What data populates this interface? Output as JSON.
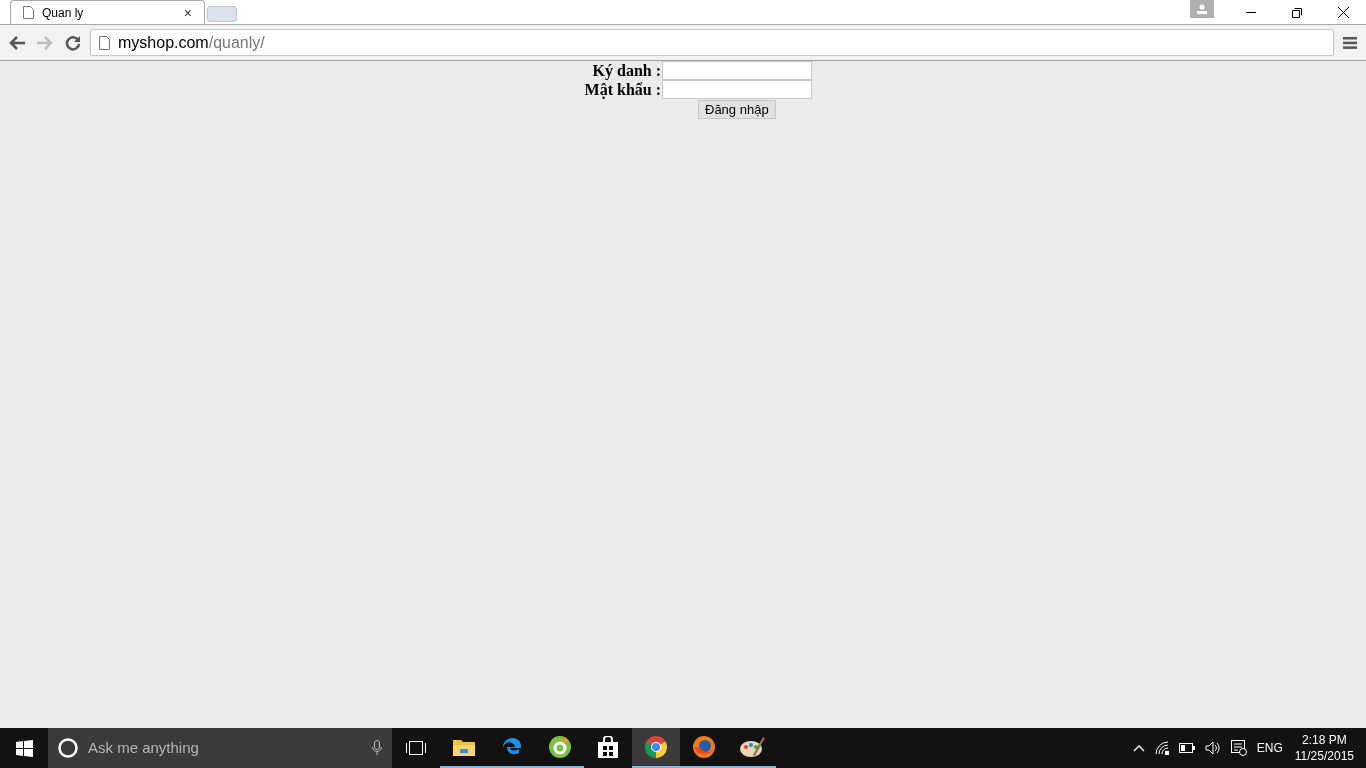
{
  "browser": {
    "tabs": [
      {
        "title": "Quan ly",
        "close": "×",
        "selected": true
      }
    ],
    "address": {
      "host": "myshop.com",
      "path": "/quanly/"
    }
  },
  "login_form": {
    "fields": [
      {
        "label": "Ký danh :"
      },
      {
        "label": "Mật khẩu :"
      }
    ],
    "submit": "Đăng nhập"
  },
  "taskbar": {
    "search_placeholder": "Ask me anything",
    "apps": [
      {
        "kind": "folder",
        "running": true,
        "selected": false
      },
      {
        "kind": "edge",
        "running": true,
        "selected": false
      },
      {
        "kind": "coccoc",
        "running": true,
        "selected": false
      },
      {
        "kind": "store",
        "running": false,
        "selected": false
      },
      {
        "kind": "chrome",
        "running": true,
        "selected": true
      },
      {
        "kind": "firefox",
        "running": true,
        "selected": false
      },
      {
        "kind": "paint",
        "running": true,
        "selected": false
      }
    ],
    "language": "ENG",
    "time": "2:18 PM",
    "date": "11/25/2015"
  }
}
